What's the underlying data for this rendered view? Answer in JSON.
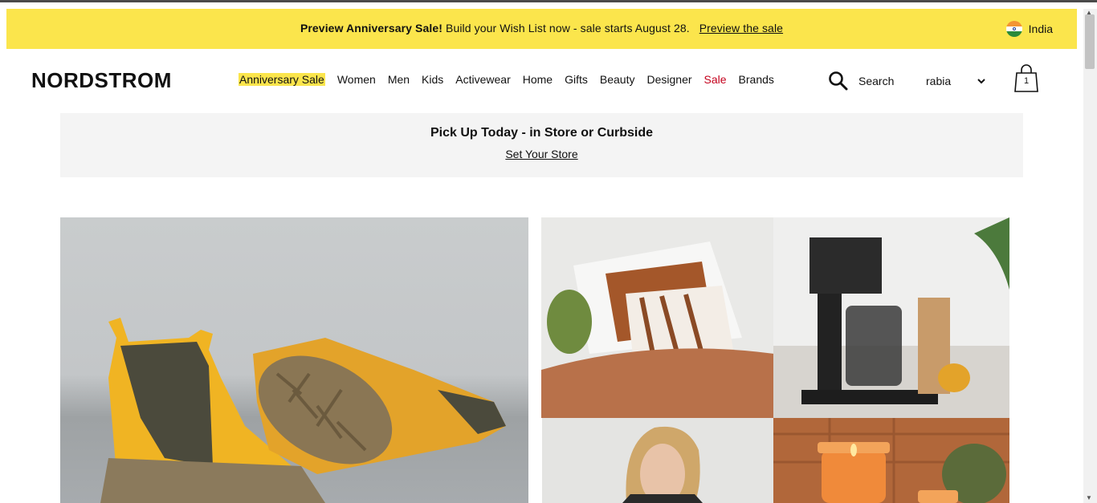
{
  "promo": {
    "bold": "Preview Anniversary Sale!",
    "text": "Build your Wish List now - sale starts August 28.",
    "link": "Preview the sale"
  },
  "country": {
    "label": "India"
  },
  "header": {
    "logo": "NORDSTROM",
    "nav": [
      "Anniversary Sale",
      "Women",
      "Men",
      "Kids",
      "Activewear",
      "Home",
      "Gifts",
      "Beauty",
      "Designer",
      "Sale",
      "Brands"
    ],
    "search_label": "Search",
    "user_name": "rabia",
    "cart_count": "1"
  },
  "pickup": {
    "title": "Pick Up Today - in Store or Curbside",
    "link": "Set Your Store"
  },
  "colors": {
    "promo_bg": "#fbe54c",
    "sale_red": "#c4001c",
    "highlight": "#fbe54c"
  },
  "icons": [
    "search-icon",
    "chevron-down-icon",
    "shopping-bag-icon",
    "india-flag-icon"
  ]
}
